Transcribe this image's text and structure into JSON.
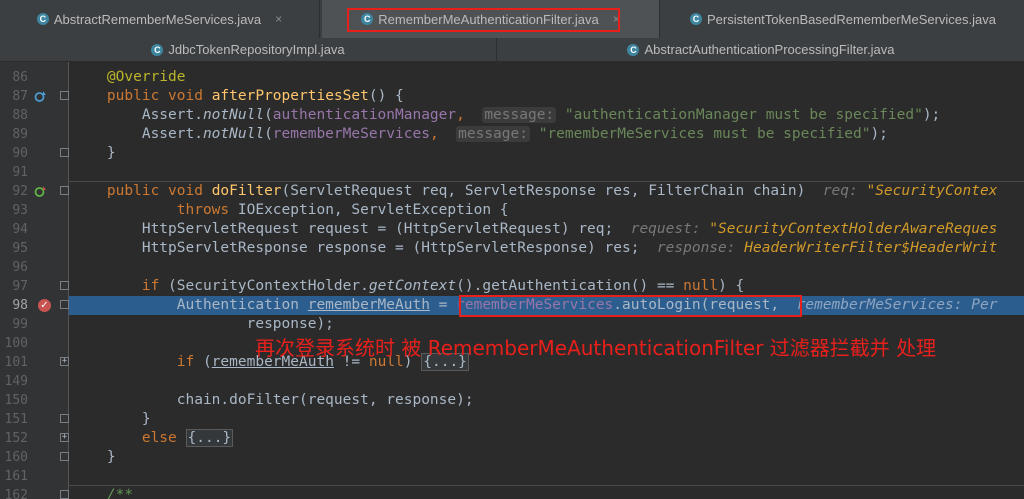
{
  "tabs_row1": [
    {
      "label": "AbstractRememberMeServices.java",
      "active": false
    },
    {
      "label": "RememberMeAuthenticationFilter.java",
      "active": true
    },
    {
      "label": "PersistentTokenBasedRememberMeServices.java",
      "active": false
    }
  ],
  "tabs_row2": [
    {
      "label": "JdbcTokenRepositoryImpl.java"
    },
    {
      "label": "AbstractAuthenticationProcessingFilter.java"
    }
  ],
  "class_icon_letter": "C",
  "close_glyph": "×",
  "line_numbers": [
    "86",
    "87",
    "88",
    "89",
    "90",
    "91",
    "92",
    "93",
    "94",
    "95",
    "96",
    "97",
    "98",
    "99",
    "100",
    "101",
    "149",
    "150",
    "151",
    "152",
    "160",
    "161",
    "162"
  ],
  "code": {
    "l86_annotation": "@Override",
    "l87_kw1": "public",
    "l87_kw2": "void",
    "l87_fn": "afterPropertiesSet",
    "l87_rest": "() {",
    "l88_a": "Assert.",
    "l88_m": "notNull",
    "l88_p": "(",
    "l88_f": "authenticationManager",
    "l88_c": ",",
    "l88_hint": "message:",
    "l88_s": "\"authenticationManager must be specified\"",
    "l88_e": ");",
    "l89_a": "Assert.",
    "l89_m": "notNull",
    "l89_p": "(",
    "l89_f": "rememberMeServices",
    "l89_c": ",",
    "l89_hint": "message:",
    "l89_s": "\"rememberMeServices must be specified\"",
    "l89_e": ");",
    "l90": "}",
    "l92_kw1": "public",
    "l92_kw2": "void",
    "l92_fn": "doFilter",
    "l92_rest": "(ServletRequest req, ServletResponse res, FilterChain chain)",
    "l92_inl": "req:",
    "l92_inlv": "\"SecurityContex",
    "l93_kw": "throws",
    "l93_rest": "IOException, ServletException {",
    "l94_code": "HttpServletRequest request = (HttpServletRequest) req;",
    "l94_inl": "request:",
    "l94_inlv": "\"SecurityContextHolderAwareReques",
    "l95_code": "HttpServletResponse response = (HttpServletResponse) res;",
    "l95_inl": "response:",
    "l95_inlv": "HeaderWriterFilter$HeaderWrit",
    "l97_kw": "if",
    "l97_a": "(SecurityContextHolder.",
    "l97_m": "getContext",
    "l97_b": "().getAuthentication() ==",
    "l97_null": "null",
    "l97_c": ") {",
    "l98_a": "Authentication",
    "l98_var": "rememberMeAuth",
    "l98_eq": "=",
    "l98_fld": "rememberMeServices",
    "l98_call": ".autoLogin(request,",
    "l98_inl": "rememberMeServices:",
    "l98_inlv": "Per",
    "l99": "response);",
    "l101_kw": "if",
    "l101_a": "(",
    "l101_var": "rememberMeAuth",
    "l101_b": "!=",
    "l101_null": "null",
    ")": ")",
    "l101_fold": "{...}",
    "l150": "chain.doFilter(request, response);",
    "l151": "}",
    "l152_kw": "else",
    "l152_fold": "{...}",
    "l161": "}",
    "l162": "/**"
  },
  "annotation_text": "再次登录系统时 被 RememberMeAuthenticationFilter 过滤器拦截并 处理",
  "colors": {
    "highlight": "#2c5d8f",
    "annotation_red": "#e8201c",
    "background": "#2b2b2b"
  },
  "gutter_icons": {
    "l87": "override-marker-icon",
    "l92": "implement-marker-icon",
    "l98": "breakpoint-icon"
  }
}
